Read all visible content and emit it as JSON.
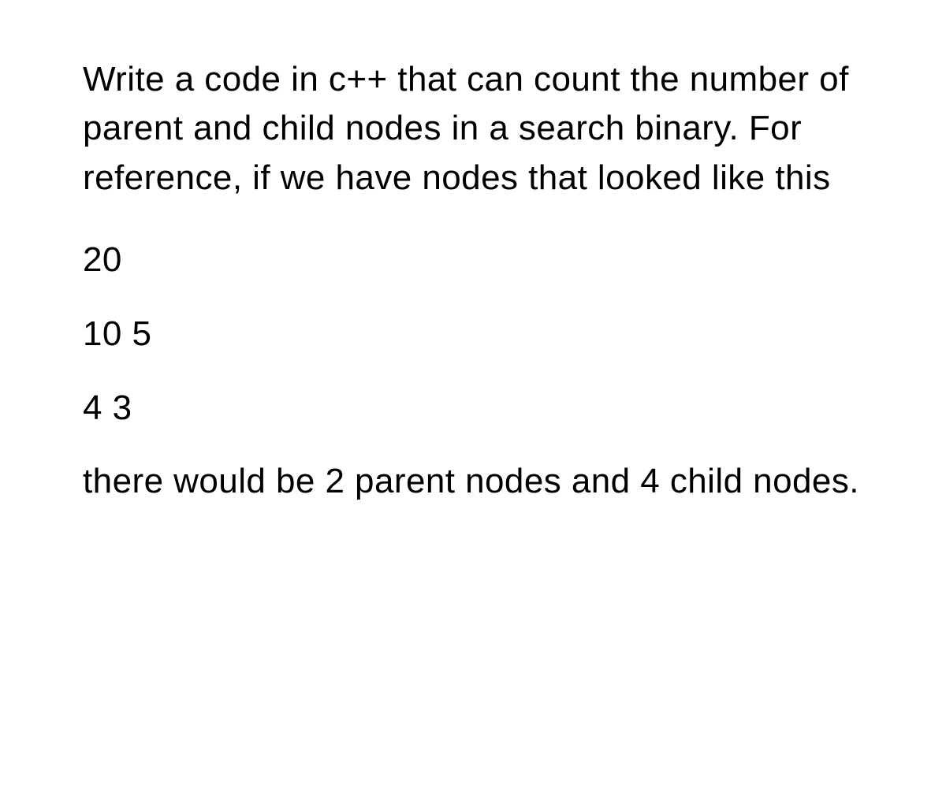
{
  "question": {
    "intro": "Write a code in c++ that can count the number of parent and child nodes in a search binary. For reference, if we have nodes that looked like this",
    "data_lines": [
      "20",
      "10 5",
      "4 3"
    ],
    "conclusion": "there would be 2 parent nodes and 4 child nodes."
  }
}
